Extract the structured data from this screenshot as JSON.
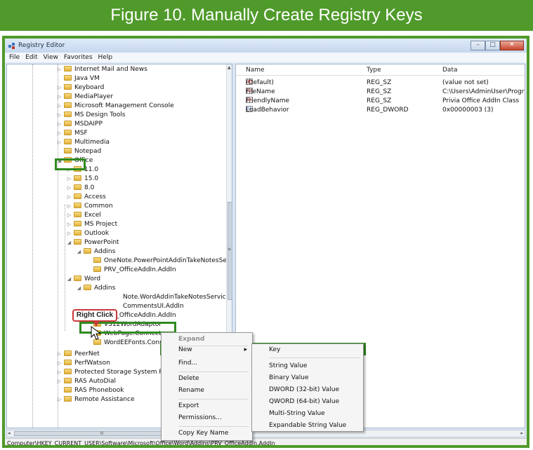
{
  "banner": {
    "title": "Figure 10. Manually Create Registry Keys"
  },
  "window": {
    "title": "Registry Editor",
    "controls": {
      "minimize": "–",
      "maximize": "□",
      "close": "✕"
    }
  },
  "menubar": {
    "items": [
      "File",
      "Edit",
      "View",
      "Favorites",
      "Help"
    ]
  },
  "tree": {
    "items": [
      "Internet Mail and News",
      "Java VM",
      "Keyboard",
      "MediaPlayer",
      "Microsoft Management Console",
      "MS Design Tools",
      "MSDAIPP",
      "MSF",
      "Multimedia",
      "Notepad",
      "Office",
      "11.0",
      "15.0",
      "8.0",
      "Access",
      "Common",
      "Excel",
      "MS Project",
      "Outlook",
      "PowerPoint",
      "Addins",
      "OneNote.PowerPointAddinTakeNotesServ",
      "PRV_OfficeAddIn.AddIn",
      "Word",
      "Addins",
      "Note.WordAddinTakeNotesService",
      "CommentsUI.AddIn",
      "PRV_OfficeAddIn.AddIn",
      "VS12WordAdaptor",
      "WebPage.Connect",
      "WordEEFonts.Conn",
      "PeerNet",
      "PerfWatson",
      "Protected Storage System Pro",
      "RAS AutoDial",
      "RAS Phonebook",
      "Remote Assistance"
    ]
  },
  "list": {
    "columns": [
      "Name",
      "Type",
      "Data"
    ],
    "rows": [
      {
        "icon": "ab",
        "name": "(Default)",
        "type": "REG_SZ",
        "data": "(value not set)"
      },
      {
        "icon": "ab",
        "name": "FileName",
        "type": "REG_SZ",
        "data": "C:\\Users\\AdminUser\\ProgramFiles"
      },
      {
        "icon": "ab",
        "name": "FriendlyName",
        "type": "REG_SZ",
        "data": "Privia Office AddIn Class"
      },
      {
        "icon": "01",
        "name": "LoadBehavior",
        "type": "REG_DWORD",
        "data": "0x00000003 (3)"
      }
    ]
  },
  "callout": {
    "text": "Right Click"
  },
  "context_menu": {
    "items": [
      "Expand",
      "New",
      "Find...",
      "Delete",
      "Rename",
      "Export",
      "Permissions...",
      "Copy Key Name"
    ],
    "submenu_arrow": "▸"
  },
  "submenu": {
    "items": [
      "Key",
      "String Value",
      "Binary Value",
      "DWORD (32-bit) Value",
      "QWORD (64-bit) Value",
      "Multi-String Value",
      "Expandable String Value"
    ]
  },
  "scroll": {
    "up": "▲",
    "down": "▼",
    "left": "◂",
    "right": "▸",
    "grip": "III",
    "vgrip": "≡"
  },
  "statusbar": {
    "path": "Computer\\HKEY_CURRENT_USER\\Software\\Microsoft\\Office\\Word\\Addins\\PRV_OfficeAddIn.AddIn"
  },
  "colors": {
    "banner": "#4f9a2a",
    "highlight_box": "#2f8a1f",
    "callout_border": "#c9393a"
  }
}
